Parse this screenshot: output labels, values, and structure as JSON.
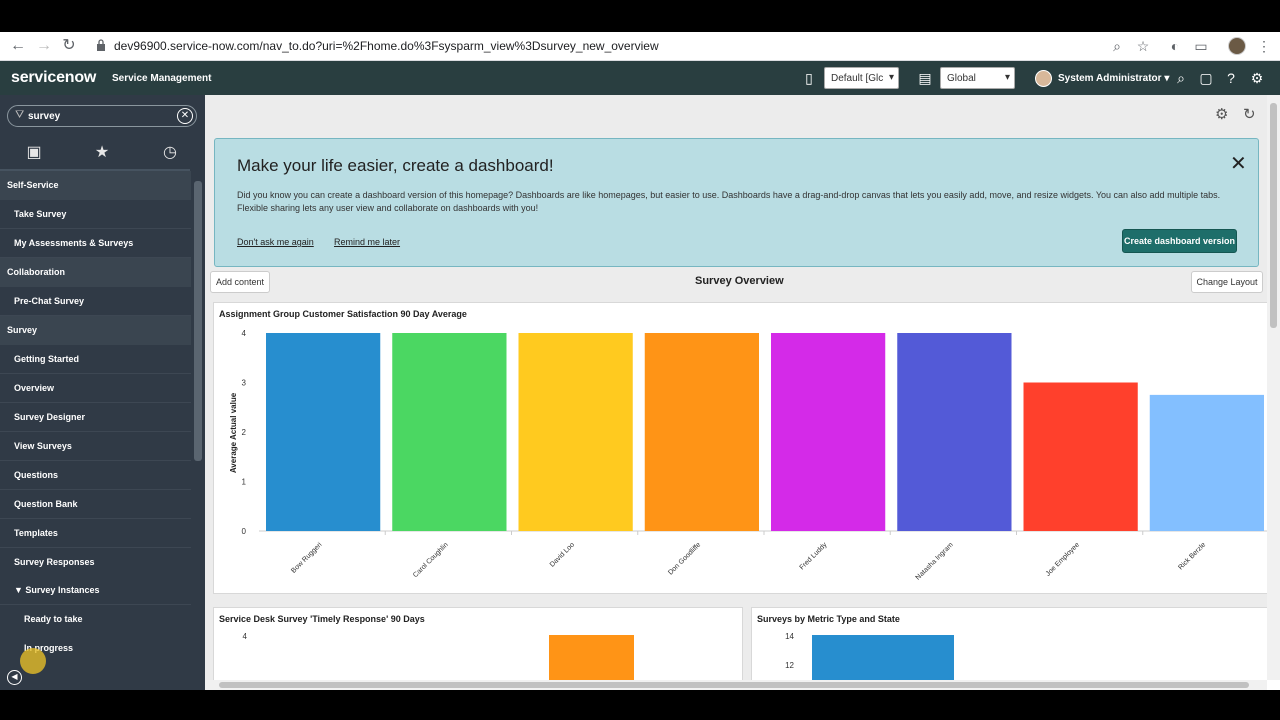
{
  "browser": {
    "url": "dev96900.service-now.com/nav_to.do?uri=%2Fhome.do%3Fsysparm_view%3Dsurvey_new_overview"
  },
  "header": {
    "logo": "servicenow",
    "app_name": "Service Management",
    "update_set": "Default [Glc",
    "scope": "Global",
    "user": "System Administrator"
  },
  "sidebar": {
    "filter_value": "survey",
    "items": [
      {
        "label": "Self-Service",
        "kind": "sec"
      },
      {
        "label": "Take Survey",
        "kind": "mod"
      },
      {
        "label": "My Assessments & Surveys",
        "kind": "mod"
      },
      {
        "label": "Collaboration",
        "kind": "sec"
      },
      {
        "label": "Pre-Chat Survey",
        "kind": "mod"
      },
      {
        "label": "Survey",
        "kind": "sec"
      },
      {
        "label": "Getting Started",
        "kind": "mod"
      },
      {
        "label": "Overview",
        "kind": "mod"
      },
      {
        "label": "Survey Designer",
        "kind": "mod"
      },
      {
        "label": "View Surveys",
        "kind": "mod"
      },
      {
        "label": "Questions",
        "kind": "mod"
      },
      {
        "label": "Question Bank",
        "kind": "mod"
      },
      {
        "label": "Templates",
        "kind": "mod"
      },
      {
        "label": "Survey Responses",
        "kind": "mod"
      },
      {
        "label": "Survey Instances",
        "kind": "mod"
      },
      {
        "label": "Ready to take",
        "kind": "sub"
      },
      {
        "label": "In progress",
        "kind": "sub"
      }
    ]
  },
  "banner": {
    "title": "Make your life easier, create a dashboard!",
    "body": "Did you know you can create a dashboard version of this homepage? Dashboards are like homepages, but easier to use. Dashboards have a drag-and-drop canvas that lets you easily add, move, and resize widgets. You can also add multiple tabs. Flexible sharing lets any user view and collaborate on dashboards with you!",
    "dont_ask": "Don't ask me again",
    "remind": "Remind me later",
    "create_btn": "Create dashboard version"
  },
  "toolbar": {
    "add_content": "Add content",
    "page_title": "Survey Overview",
    "change_layout": "Change Layout"
  },
  "chart_data": [
    {
      "type": "bar",
      "title": "Assignment Group Customer Satisfaction 90 Day Average",
      "ylabel": "Average Actual value",
      "xlabel": "",
      "categories": [
        "Bow Ruggeri",
        "Carol Coughlin",
        "David Loo",
        "Don Goodliffe",
        "Fred Luddy",
        "Natasha Ingram",
        "Joe Employee",
        "Rick Berzle"
      ],
      "values": [
        4,
        4,
        4,
        4,
        4,
        4,
        3,
        2.75
      ],
      "colors": [
        "#278ecf",
        "#4bd762",
        "#ffca1f",
        "#ff9416",
        "#d42ae8",
        "#535ad7",
        "#ff402c",
        "#83bfff"
      ],
      "yticks": [
        "0",
        "1",
        "2",
        "3",
        "4"
      ],
      "ylim": [
        0,
        4
      ]
    },
    {
      "type": "bar",
      "title": "Service Desk Survey 'Timely Response' 90 Days",
      "yticks_visible": [
        "4"
      ],
      "bar_color": "#ff9416"
    },
    {
      "type": "bar",
      "title": "Surveys by Metric Type and State",
      "yticks_visible": [
        "14",
        "12"
      ],
      "bar_color": "#278ecf"
    }
  ]
}
